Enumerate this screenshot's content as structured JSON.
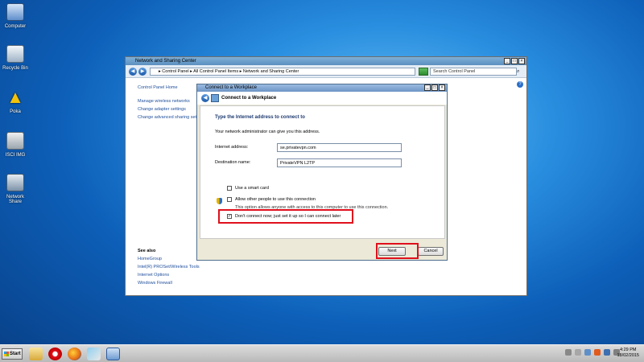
{
  "desktop": {
    "icons": [
      {
        "label": "Computer"
      },
      {
        "label": "Recycle Bin"
      },
      {
        "label": "Poka"
      },
      {
        "label": "ISCI IMG"
      },
      {
        "label": "Network Share"
      }
    ]
  },
  "control_panel": {
    "title": "Network and Sharing Center",
    "address": "▸ Control Panel ▸ All Control Panel Items ▸ Network and Sharing Center",
    "search_placeholder": "Search Control Panel",
    "sidebar": {
      "home": "Control Panel Home",
      "links": [
        "Manage wireless networks",
        "Change adapter settings",
        "Change advanced sharing sett"
      ]
    },
    "see_also": {
      "header": "See also",
      "items": [
        "HomeGroup",
        "Intel(R) PROSet/Wireless Tools",
        "Internet Options",
        "Windows Firewall"
      ]
    }
  },
  "dialog": {
    "title": "Connect to a Workplace",
    "header": "Connect to a Workplace",
    "heading": "Type the Internet address to connect to",
    "subtext": "Your network administrator can give you this address.",
    "internet_address_label": "Internet address:",
    "internet_address_value": "se.privatevpn.com",
    "destination_label": "Destination name:",
    "destination_value": "PrivateVPN L2TP",
    "smart_card": "Use a smart card",
    "allow_others": "Allow other people to use this connection",
    "allow_hint": "This option allows anyone with access to this computer to use this connection.",
    "dont_connect": "Don't connect now; just set it up so I can connect later",
    "dont_connect_checked": true,
    "next": "Next",
    "cancel": "Cancel"
  },
  "taskbar": {
    "start": "Start",
    "time": "4:29 PM",
    "date": "18/02/2015"
  }
}
